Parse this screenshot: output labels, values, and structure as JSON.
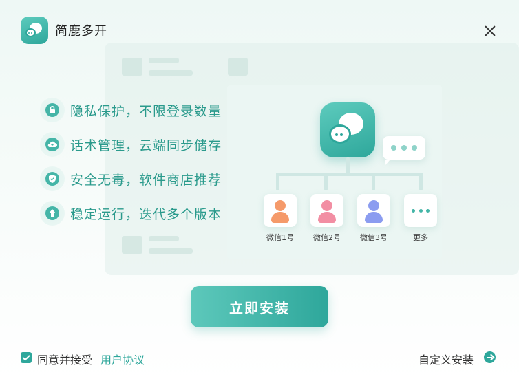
{
  "app": {
    "title": "简鹿多开"
  },
  "features": [
    {
      "icon": "lock-icon",
      "label": "隐私保护，不限登录数量"
    },
    {
      "icon": "cloud-upload-icon",
      "label": "话术管理，云端同步储存"
    },
    {
      "icon": "shield-check-icon",
      "label": "安全无毒，软件商店推荐"
    },
    {
      "icon": "arrow-up-icon",
      "label": "稳定运行，迭代多个版本"
    }
  ],
  "diagram": {
    "nodes": [
      {
        "label": "微信1号",
        "color": "#f59a6a"
      },
      {
        "label": "微信2号",
        "color": "#f28ea3"
      },
      {
        "label": "微信3号",
        "color": "#8b9cf0"
      },
      {
        "label": "更多"
      }
    ]
  },
  "install_button": "立即安装",
  "footer": {
    "agree_text": "同意并接受",
    "agree_link": "用户协议",
    "agreed": true,
    "custom_install": "自定义安装"
  },
  "colors": {
    "accent": "#2ea79b",
    "accent_light": "#5dcbbd",
    "text_feature": "#2a9a8c"
  }
}
